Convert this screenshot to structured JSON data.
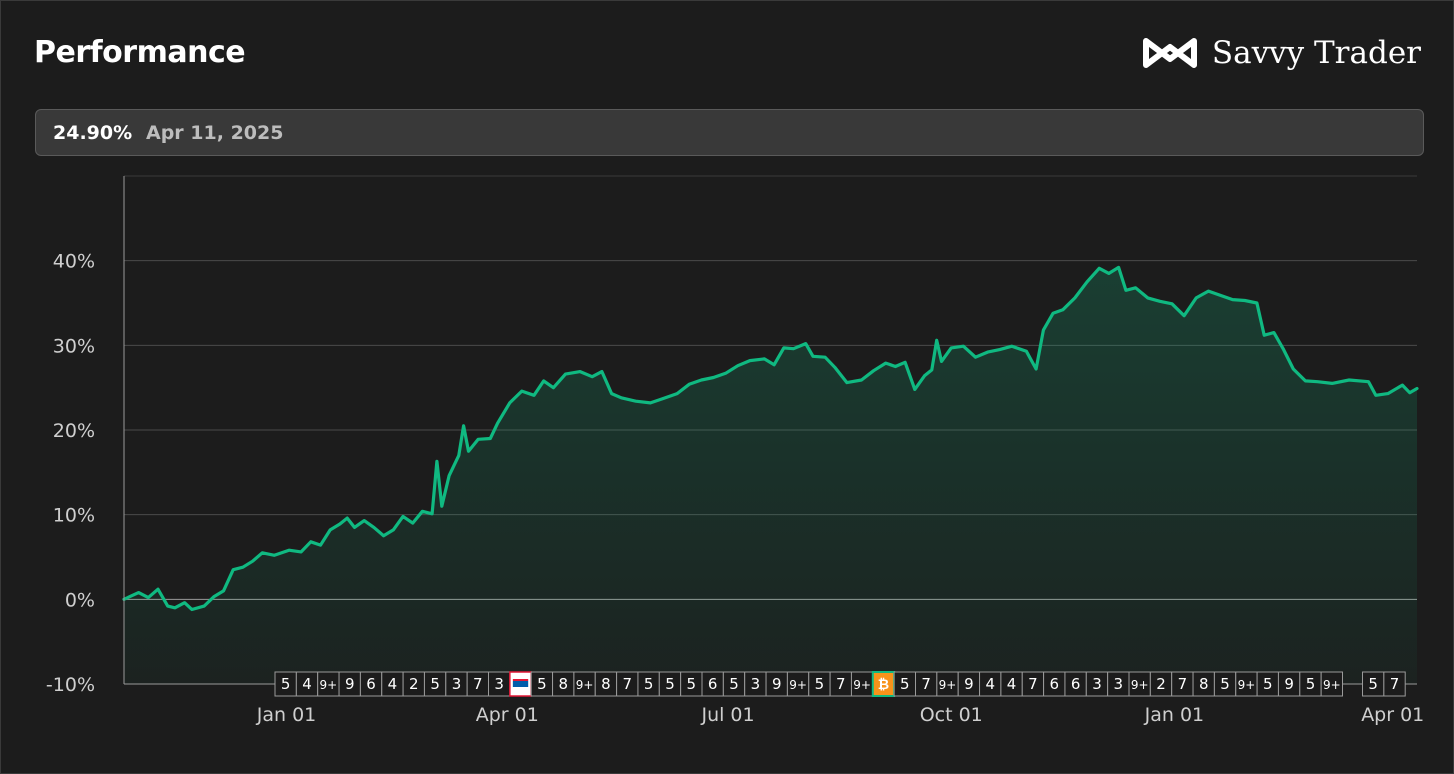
{
  "header": {
    "title": "Performance",
    "brand": "Savvy Trader",
    "brand_icon": "savvy-trader-logo-icon"
  },
  "tooltip": {
    "value": "24.90%",
    "date": "Apr 11, 2025"
  },
  "colors": {
    "line": "#10b981",
    "background": "#1c1c1c",
    "grid": "#4a4a4a",
    "badge_border": "#9a9a9a"
  },
  "chart_data": {
    "type": "area",
    "ylim": [
      -10,
      50
    ],
    "yticks": [
      -10,
      0,
      10,
      20,
      30,
      40
    ],
    "ytick_labels": [
      "-10%",
      "0%",
      "10%",
      "20%",
      "30%",
      "40%"
    ],
    "xlim": [
      "2023-10-26",
      "2025-04-11"
    ],
    "xticks": [
      "2024-01-01",
      "2024-04-01",
      "2024-07-01",
      "2024-10-01",
      "2025-01-01",
      "2025-04-01"
    ],
    "xtick_labels": [
      "Jan 01",
      "Apr 01",
      "Jul 01",
      "Oct 01",
      "Jan 01",
      "Apr 01"
    ],
    "grid": true,
    "points": [
      [
        "2023-10-26",
        0.0
      ],
      [
        "2023-11-01",
        0.8
      ],
      [
        "2023-11-05",
        0.2
      ],
      [
        "2023-11-09",
        1.2
      ],
      [
        "2023-11-13",
        -0.8
      ],
      [
        "2023-11-16",
        -1.0
      ],
      [
        "2023-11-20",
        -0.4
      ],
      [
        "2023-11-23",
        -1.2
      ],
      [
        "2023-11-28",
        -0.8
      ],
      [
        "2023-12-02",
        0.3
      ],
      [
        "2023-12-06",
        1.0
      ],
      [
        "2023-12-10",
        3.5
      ],
      [
        "2023-12-14",
        3.8
      ],
      [
        "2023-12-18",
        4.5
      ],
      [
        "2023-12-22",
        5.5
      ],
      [
        "2023-12-27",
        5.2
      ],
      [
        "2024-01-02",
        5.8
      ],
      [
        "2024-01-07",
        5.6
      ],
      [
        "2024-01-11",
        6.8
      ],
      [
        "2024-01-15",
        6.4
      ],
      [
        "2024-01-19",
        8.2
      ],
      [
        "2024-01-23",
        8.9
      ],
      [
        "2024-01-26",
        9.6
      ],
      [
        "2024-01-29",
        8.5
      ],
      [
        "2024-02-02",
        9.3
      ],
      [
        "2024-02-06",
        8.5
      ],
      [
        "2024-02-10",
        7.5
      ],
      [
        "2024-02-14",
        8.2
      ],
      [
        "2024-02-18",
        9.8
      ],
      [
        "2024-02-22",
        9.0
      ],
      [
        "2024-02-26",
        10.4
      ],
      [
        "2024-03-01",
        10.1
      ],
      [
        "2024-03-03",
        16.3
      ],
      [
        "2024-03-05",
        11.0
      ],
      [
        "2024-03-08",
        14.6
      ],
      [
        "2024-03-12",
        17.0
      ],
      [
        "2024-03-14",
        20.5
      ],
      [
        "2024-03-16",
        17.5
      ],
      [
        "2024-03-20",
        18.9
      ],
      [
        "2024-03-25",
        19.0
      ],
      [
        "2024-03-28",
        20.8
      ],
      [
        "2024-04-02",
        23.2
      ],
      [
        "2024-04-07",
        24.6
      ],
      [
        "2024-04-12",
        24.1
      ],
      [
        "2024-04-16",
        25.8
      ],
      [
        "2024-04-20",
        25.0
      ],
      [
        "2024-04-25",
        26.6
      ],
      [
        "2024-05-01",
        26.9
      ],
      [
        "2024-05-06",
        26.3
      ],
      [
        "2024-05-10",
        26.9
      ],
      [
        "2024-05-14",
        24.3
      ],
      [
        "2024-05-18",
        23.8
      ],
      [
        "2024-05-24",
        23.4
      ],
      [
        "2024-05-30",
        23.2
      ],
      [
        "2024-06-04",
        23.7
      ],
      [
        "2024-06-10",
        24.3
      ],
      [
        "2024-06-15",
        25.4
      ],
      [
        "2024-06-20",
        25.9
      ],
      [
        "2024-06-25",
        26.2
      ],
      [
        "2024-06-30",
        26.7
      ],
      [
        "2024-07-05",
        27.6
      ],
      [
        "2024-07-10",
        28.2
      ],
      [
        "2024-07-16",
        28.4
      ],
      [
        "2024-07-20",
        27.7
      ],
      [
        "2024-07-24",
        29.7
      ],
      [
        "2024-07-28",
        29.6
      ],
      [
        "2024-08-02",
        30.2
      ],
      [
        "2024-08-05",
        28.7
      ],
      [
        "2024-08-10",
        28.6
      ],
      [
        "2024-08-14",
        27.4
      ],
      [
        "2024-08-19",
        25.6
      ],
      [
        "2024-08-25",
        25.9
      ],
      [
        "2024-08-30",
        27.0
      ],
      [
        "2024-09-04",
        27.9
      ],
      [
        "2024-09-08",
        27.5
      ],
      [
        "2024-09-12",
        28.0
      ],
      [
        "2024-09-16",
        24.8
      ],
      [
        "2024-09-20",
        26.4
      ],
      [
        "2024-09-23",
        27.1
      ],
      [
        "2024-09-25",
        30.6
      ],
      [
        "2024-09-27",
        28.1
      ],
      [
        "2024-10-01",
        29.7
      ],
      [
        "2024-10-06",
        29.9
      ],
      [
        "2024-10-11",
        28.6
      ],
      [
        "2024-10-16",
        29.2
      ],
      [
        "2024-10-21",
        29.5
      ],
      [
        "2024-10-26",
        29.9
      ],
      [
        "2024-11-01",
        29.3
      ],
      [
        "2024-11-05",
        27.2
      ],
      [
        "2024-11-08",
        31.8
      ],
      [
        "2024-11-12",
        33.8
      ],
      [
        "2024-11-16",
        34.2
      ],
      [
        "2024-11-21",
        35.6
      ],
      [
        "2024-11-26",
        37.5
      ],
      [
        "2024-12-01",
        39.1
      ],
      [
        "2024-12-05",
        38.5
      ],
      [
        "2024-12-09",
        39.2
      ],
      [
        "2024-12-12",
        36.5
      ],
      [
        "2024-12-16",
        36.8
      ],
      [
        "2024-12-21",
        35.6
      ],
      [
        "2024-12-26",
        35.2
      ],
      [
        "2024-12-31",
        34.9
      ],
      [
        "2025-01-05",
        33.5
      ],
      [
        "2025-01-10",
        35.6
      ],
      [
        "2025-01-15",
        36.4
      ],
      [
        "2025-01-20",
        35.9
      ],
      [
        "2025-01-25",
        35.4
      ],
      [
        "2025-01-30",
        35.3
      ],
      [
        "2025-02-04",
        35.0
      ],
      [
        "2025-02-07",
        31.2
      ],
      [
        "2025-02-11",
        31.5
      ],
      [
        "2025-02-15",
        29.5
      ],
      [
        "2025-02-19",
        27.2
      ],
      [
        "2025-02-24",
        25.8
      ],
      [
        "2025-03-01",
        25.7
      ],
      [
        "2025-03-07",
        25.5
      ],
      [
        "2025-03-14",
        25.9
      ],
      [
        "2025-03-22",
        25.7
      ],
      [
        "2025-03-25",
        24.1
      ],
      [
        "2025-03-30",
        24.3
      ],
      [
        "2025-04-05",
        25.3
      ],
      [
        "2025-04-08",
        24.4
      ],
      [
        "2025-04-11",
        24.9
      ]
    ],
    "event_badges": [
      {
        "label": "5"
      },
      {
        "label": "4"
      },
      {
        "label": "9+"
      },
      {
        "label": "9"
      },
      {
        "label": "6"
      },
      {
        "label": "4"
      },
      {
        "label": "2"
      },
      {
        "label": "5"
      },
      {
        "label": "3"
      },
      {
        "label": "7"
      },
      {
        "label": "3"
      },
      {
        "label": "",
        "logo": "costco-logo"
      },
      {
        "label": "5"
      },
      {
        "label": "8"
      },
      {
        "label": "9+"
      },
      {
        "label": "8"
      },
      {
        "label": "7"
      },
      {
        "label": "5"
      },
      {
        "label": "5"
      },
      {
        "label": "5"
      },
      {
        "label": "6"
      },
      {
        "label": "5"
      },
      {
        "label": "3"
      },
      {
        "label": "9"
      },
      {
        "label": "9+"
      },
      {
        "label": "5"
      },
      {
        "label": "7"
      },
      {
        "label": "9+"
      },
      {
        "label": "",
        "logo": "bitcoin-logo"
      },
      {
        "label": "5"
      },
      {
        "label": "7"
      },
      {
        "label": "9+"
      },
      {
        "label": "9"
      },
      {
        "label": "4"
      },
      {
        "label": "4"
      },
      {
        "label": "7"
      },
      {
        "label": "6"
      },
      {
        "label": "6"
      },
      {
        "label": "3"
      },
      {
        "label": "3"
      },
      {
        "label": "9+"
      },
      {
        "label": "2"
      },
      {
        "label": "7"
      },
      {
        "label": "8"
      },
      {
        "label": "5"
      },
      {
        "label": "9+"
      },
      {
        "label": "5"
      },
      {
        "label": "9"
      },
      {
        "label": "5"
      },
      {
        "label": "9+"
      },
      {
        "label": "5",
        "gap_before": true
      },
      {
        "label": "7"
      }
    ]
  }
}
